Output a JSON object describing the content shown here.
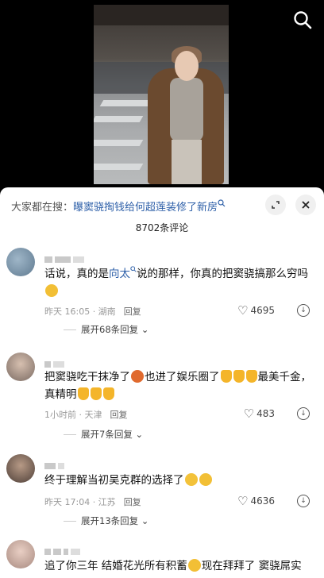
{
  "hot_search": {
    "prefix": "大家都在搜：",
    "query": "曝窦骁掏钱给何超莲装修了新房"
  },
  "comment_count": "8702条评论",
  "icons": {
    "search": "search-icon",
    "minimize": "minimize-icon",
    "close": "close-icon",
    "heart": "heart-icon",
    "dislike": "dislike-icon"
  },
  "comments": [
    {
      "text_a": "话说，真的是",
      "link": "向太",
      "text_b": "说的那样，你真的把窦骁搞那么穷吗",
      "time": "昨天 16:05 · 湖南",
      "reply": "回复",
      "likes": "4695",
      "expand": "展开68条回复"
    },
    {
      "text_a": "把窦骁吃干抹净了",
      "text_b": "也进了娱乐圈了",
      "text_c": "最美千金，真精明",
      "time": "1小时前 · 天津",
      "reply": "回复",
      "likes": "483",
      "expand": "展开7条回复"
    },
    {
      "text_a": "终于理解当初吴克群的选择了",
      "time": "昨天 17:04 · 江苏",
      "reply": "回复",
      "likes": "4636",
      "expand": "展开13条回复"
    },
    {
      "text_a": "追了你三年 结婚花光所有积蓄",
      "text_b": "现在拜拜了 窦骁屌实"
    }
  ]
}
